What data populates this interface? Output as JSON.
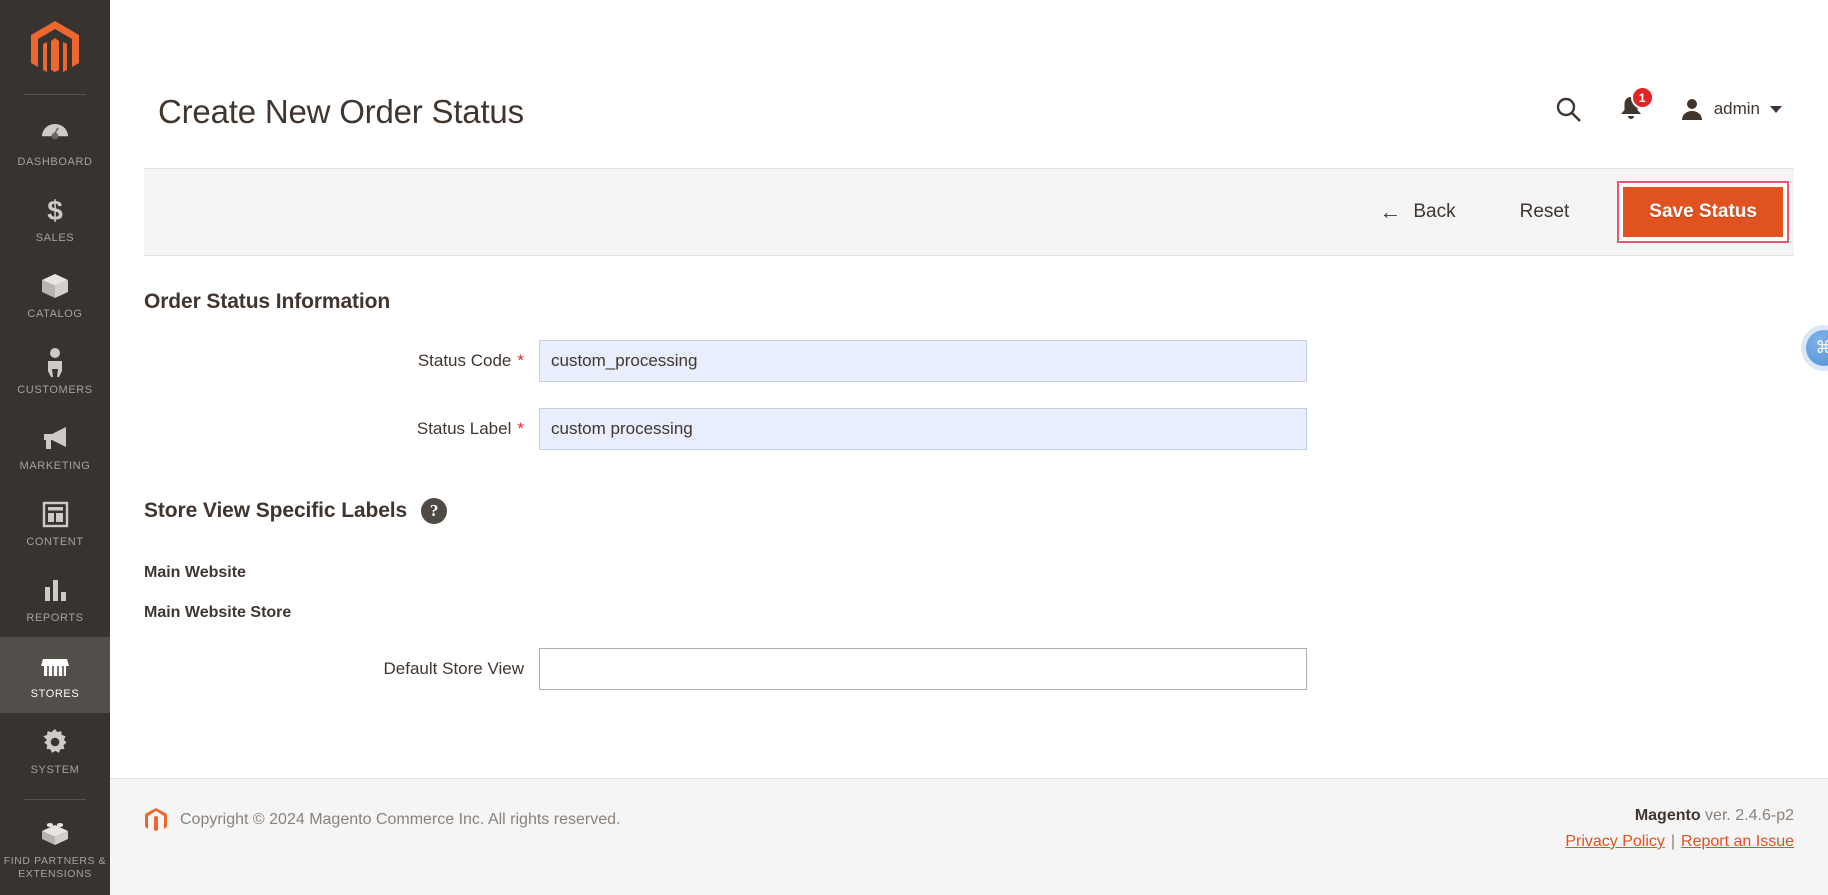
{
  "sidebar": {
    "logo_name": "magento-logo",
    "items": [
      {
        "label": "DASHBOARD",
        "icon": "dashboard-icon",
        "active": false
      },
      {
        "label": "SALES",
        "icon": "sales-icon",
        "active": false
      },
      {
        "label": "CATALOG",
        "icon": "catalog-icon",
        "active": false
      },
      {
        "label": "CUSTOMERS",
        "icon": "customers-icon",
        "active": false
      },
      {
        "label": "MARKETING",
        "icon": "marketing-icon",
        "active": false
      },
      {
        "label": "CONTENT",
        "icon": "content-icon",
        "active": false
      },
      {
        "label": "REPORTS",
        "icon": "reports-icon",
        "active": false
      },
      {
        "label": "STORES",
        "icon": "stores-icon",
        "active": true
      },
      {
        "label": "SYSTEM",
        "icon": "system-icon",
        "active": false
      },
      {
        "label": "FIND PARTNERS & EXTENSIONS",
        "icon": "find-partners-icon",
        "active": false
      }
    ]
  },
  "header": {
    "title": "Create New Order Status",
    "search_icon": "search-icon",
    "notifications_icon": "bell-icon",
    "notifications_count": "1",
    "user_icon": "user-avatar-icon",
    "user_name": "admin",
    "caret_icon": "chevron-down-icon"
  },
  "toolbar": {
    "back_label": "Back",
    "back_icon": "arrow-left-icon",
    "reset_label": "Reset",
    "save_label": "Save Status",
    "save_accent": "#e0521f",
    "focus_ring": "#e8556d"
  },
  "order_status_information": {
    "section_title": "Order Status Information",
    "fields": [
      {
        "label": "Status Code",
        "required": "*",
        "value": "custom_processing",
        "state": "autofill"
      },
      {
        "label": "Status Label",
        "required": "*",
        "value": "custom processing",
        "state": "autofill"
      }
    ]
  },
  "store_view_specific_labels": {
    "section_title": "Store View Specific Labels",
    "help_icon": "question-mark-icon",
    "help_glyph": "?",
    "website": "Main Website",
    "store_group": "Main Website Store",
    "store_view_label": "Default Store View",
    "store_view_value": ""
  },
  "footer": {
    "logo_name": "magento-mark-icon",
    "copyright": "Copyright © 2024 Magento Commerce Inc. All rights reserved.",
    "brand": "Magento",
    "version": " ver. 2.4.6-p2",
    "privacy_link": "Privacy Policy",
    "separator": "|",
    "report_link": "Report an Issue"
  },
  "edge_widget": {
    "icon": "accessibility-widget-icon",
    "glyph": "⌘"
  }
}
